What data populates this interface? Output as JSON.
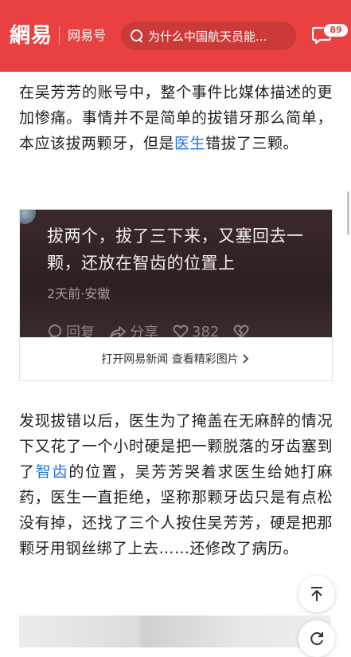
{
  "header": {
    "logo": "網易",
    "channel": "网易号",
    "search_placeholder": "为什么中国航天员能...",
    "message_badge": "89",
    "bg_color": "#e94141"
  },
  "article": {
    "p1_a": "在吴芳芳的账号中，整个事件比媒体描述的更加惨痛。事情并不是简单的拔错牙那么简单，本应该拔两颗牙，但是",
    "p1_link": "医生",
    "p1_b": "错拔了三颗。",
    "p2_a": "发现拔错以后，医生为了掩盖在无麻醉的情况下又花了一个小时硬是把一颗脱落的牙齿塞到了",
    "p2_link": "智齿",
    "p2_b": "的位置，吴芳芳哭着求医生给她打麻药，医生一直拒绝，坚称那颗牙齿只是有点松没有掉，还找了三个人按住吴芳芳，硬是把那颗牙用钢丝绑了上去……还修改了病历。",
    "link_color": "#1f74d9"
  },
  "card": {
    "text": "拔两个，拔了三下来，又塞回去一颗，还放在智齿的位置上",
    "meta": "2天前·安徽",
    "reply": "回复",
    "share": "分享",
    "likes": "382",
    "footer": "打开网易新闻 查看精彩图片"
  },
  "icons": [
    "search-icon",
    "message-icon",
    "reply-icon",
    "share-icon",
    "heart-icon",
    "broken-heart-icon",
    "chevron-right-icon",
    "back-to-top-icon",
    "refresh-icon"
  ]
}
